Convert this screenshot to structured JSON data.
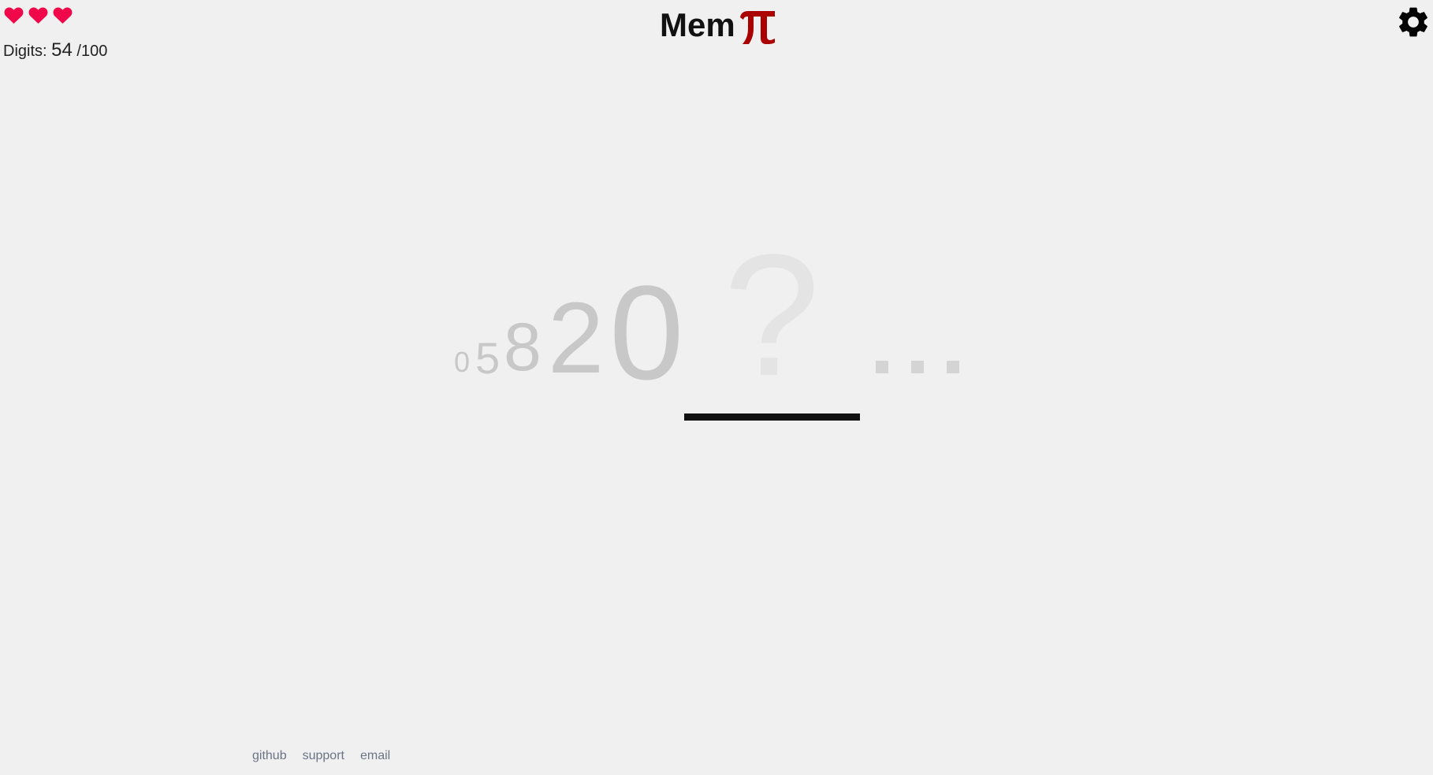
{
  "header": {
    "lives_count": 3,
    "lives_icon": "heart-icon",
    "lives_color": "#f0094a",
    "digits_label": "Digits:",
    "digits_count": "54",
    "digits_total": "/100",
    "logo_text": "Mem",
    "logo_symbol": "π",
    "logo_symbol_color": "#aa0000",
    "settings_icon": "gear-icon"
  },
  "game": {
    "digits": [
      "0",
      "5",
      "8",
      "2",
      "0"
    ],
    "next_prompt": "?",
    "upcoming_placeholder": "...",
    "answer_value": ""
  },
  "footer": {
    "links": [
      "github",
      "support",
      "email"
    ]
  }
}
